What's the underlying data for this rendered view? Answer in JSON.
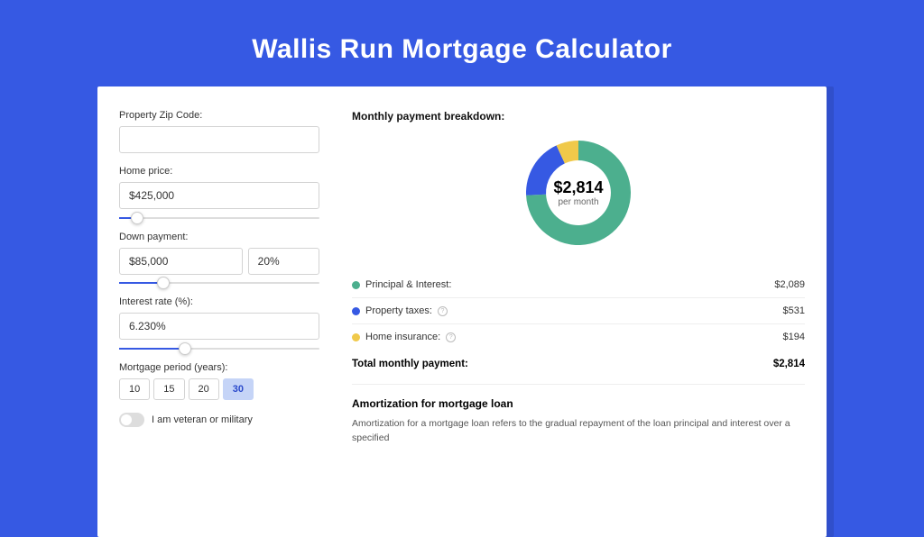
{
  "title": "Wallis Run Mortgage Calculator",
  "form": {
    "zip_label": "Property Zip Code:",
    "zip_value": "",
    "home_price_label": "Home price:",
    "home_price_value": "$425,000",
    "home_price_slider_pct": 9,
    "down_payment_label": "Down payment:",
    "down_payment_value": "$85,000",
    "down_payment_pct_value": "20%",
    "down_payment_slider_pct": 22,
    "interest_label": "Interest rate (%):",
    "interest_value": "6.230%",
    "interest_slider_pct": 33,
    "period_label": "Mortgage period (years):",
    "periods": [
      "10",
      "15",
      "20",
      "30"
    ],
    "period_selected": "30",
    "veteran_label": "I am veteran or military"
  },
  "breakdown": {
    "title": "Monthly payment breakdown:",
    "center_amount": "$2,814",
    "center_sub": "per month",
    "items": [
      {
        "name": "Principal & Interest:",
        "value": "$2,089",
        "color": "green",
        "has_info": false,
        "data_name": "principal-interest"
      },
      {
        "name": "Property taxes:",
        "value": "$531",
        "color": "blue",
        "has_info": true,
        "data_name": "property-taxes"
      },
      {
        "name": "Home insurance:",
        "value": "$194",
        "color": "yellow",
        "has_info": true,
        "data_name": "home-insurance"
      }
    ],
    "total_label": "Total monthly payment:",
    "total_value": "$2,814"
  },
  "amortization": {
    "title": "Amortization for mortgage loan",
    "text": "Amortization for a mortgage loan refers to the gradual repayment of the loan principal and interest over a specified"
  },
  "chart_data": {
    "type": "pie",
    "title": "Monthly payment breakdown",
    "series": [
      {
        "name": "Principal & Interest",
        "value": 2089,
        "color": "#4caf8e"
      },
      {
        "name": "Property taxes",
        "value": 531,
        "color": "#3659e3"
      },
      {
        "name": "Home insurance",
        "value": 194,
        "color": "#f0c94a"
      }
    ],
    "total": 2814,
    "donut_inner_radius_pct": 62
  }
}
